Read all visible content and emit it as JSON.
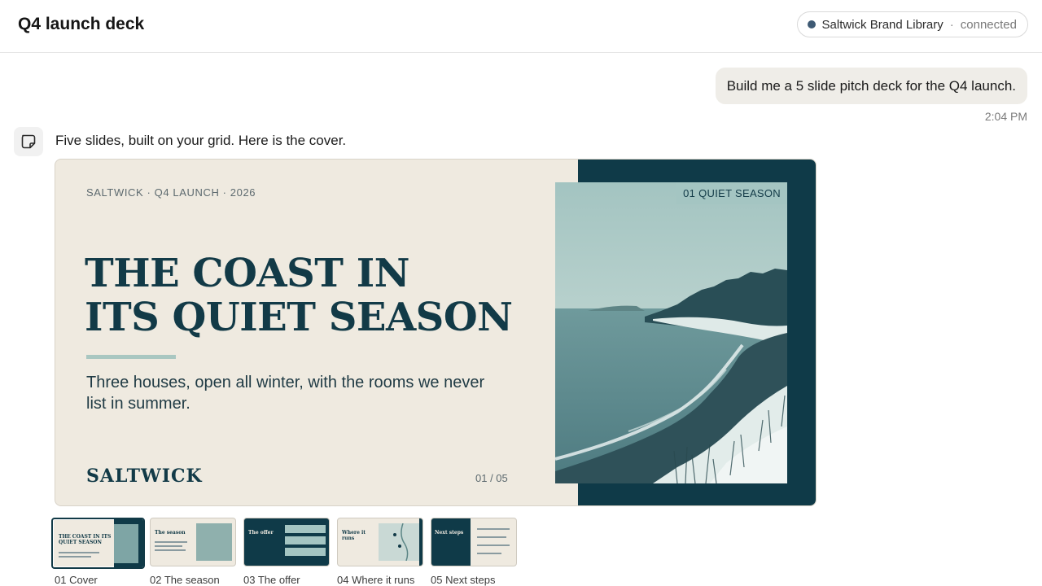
{
  "header": {
    "title": "Q4 launch deck",
    "connection": {
      "name": "Saltwick Brand Library",
      "separator": "·",
      "status": "connected",
      "dot_color": "#3e5a74"
    }
  },
  "chat": {
    "user_message": "Build me a 5 slide pitch deck for the Q4 launch.",
    "user_time": "2:04 PM",
    "assistant_icon": "note-icon",
    "assistant_message": "Five slides, built on your grid. Here is the cover."
  },
  "slide": {
    "eyebrow": "SALTWICK · Q4 LAUNCH · 2026",
    "title_line1": "THE COAST IN",
    "title_line2": "ITS QUIET SEASON",
    "subtitle": "Three houses, open all winter, with the rooms we never list in summer.",
    "logo": "SALTWICK",
    "page": "01 / 05",
    "photo_tag": "01 QUIET SEASON",
    "colors": {
      "paper": "#efeae0",
      "ink": "#123a47",
      "dark": "#0f3a48",
      "accent": "#a9c7c1"
    }
  },
  "thumbnails": [
    {
      "label": "01 Cover",
      "active": true,
      "mini_title": "THE COAST IN ITS QUIET SEASON"
    },
    {
      "label": "02 The season",
      "active": false,
      "mini_title": "The season"
    },
    {
      "label": "03 The offer",
      "active": false,
      "mini_title": "The offer"
    },
    {
      "label": "04 Where it runs",
      "active": false,
      "mini_title": "Where it runs"
    },
    {
      "label": "05 Next steps",
      "active": false,
      "mini_title": "Next steps"
    }
  ]
}
